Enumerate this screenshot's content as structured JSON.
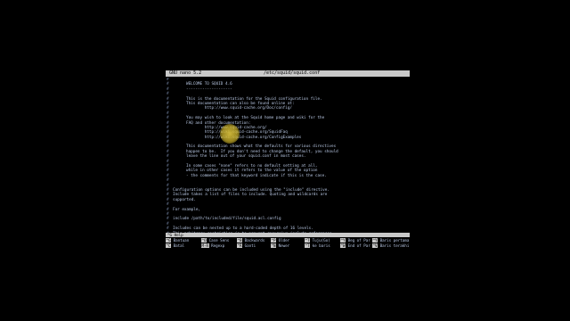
{
  "titlebar": {
    "app": "GNU nano 5.2",
    "file": "/etc/squid/squid.conf"
  },
  "lines": [
    {
      "h": "#",
      "t": ""
    },
    {
      "h": "#",
      "t": "WELCOME TO SQUID 4.6"
    },
    {
      "h": "#",
      "t": "--------------------"
    },
    {
      "h": "#",
      "t": ""
    },
    {
      "h": "#",
      "t": "This is the documentation for the Squid configuration file."
    },
    {
      "h": "#",
      "t": "This documentation can also be found online at:"
    },
    {
      "h": "#",
      "t": "        http://www.squid-cache.org/Doc/config/"
    },
    {
      "h": "#",
      "t": ""
    },
    {
      "h": "#",
      "t": "You may wish to look at the Squid home page and wiki for the"
    },
    {
      "h": "#",
      "t": "FAQ and other documentation:"
    },
    {
      "h": "#",
      "t": "        http://www.squid-cache.org/"
    },
    {
      "h": "#",
      "t": "        http://wiki.squid-cache.org/SquidFaq"
    },
    {
      "h": "#",
      "t": "        http://wiki.squid-cache.org/ConfigExamples"
    },
    {
      "h": "#",
      "t": ""
    },
    {
      "h": "#",
      "t": "This documentation shows what the defaults for various directives"
    },
    {
      "h": "#",
      "t": "happen to be.  If you don't need to change the default, you should"
    },
    {
      "h": "#",
      "t": "leave the line out of your squid.conf in most cases."
    },
    {
      "h": "#",
      "t": ""
    },
    {
      "h": "#",
      "t": "In some cases \"none\" refers to no default setting at all,"
    },
    {
      "h": "#",
      "t": "while in other cases it refers to the value of the option"
    },
    {
      "h": "#",
      "t": "- the comments for that keyword indicate if this is the case."
    },
    {
      "h": "#",
      "t": ""
    },
    {
      "h": "#",
      "t": "",
      "block": true
    },
    {
      "h": "#",
      "t": "Configuration options can be included using the \"include\" directive.",
      "block": true
    },
    {
      "h": "#",
      "t": "Include takes a list of files to include. Quoting and wildcards are",
      "block": true
    },
    {
      "h": "#",
      "t": "supported.",
      "block": true
    },
    {
      "h": "#",
      "t": "",
      "block": true
    },
    {
      "h": "#",
      "t": "For example,",
      "block": true
    },
    {
      "h": "#",
      "t": "",
      "block": true
    },
    {
      "h": "#",
      "t": "include /path/to/included/file/squid.acl.config",
      "block": true
    },
    {
      "h": "#",
      "t": "",
      "block": true
    },
    {
      "h": "#",
      "t": "Includes can be nested up to a hard-coded depth of 16 levels.",
      "block": true
    },
    {
      "h": "#",
      "t": "This arbitrary restriction is to prevent recursive include references",
      "block": true
    }
  ],
  "statusbar": "^G Help",
  "shortcuts": [
    [
      {
        "key": "^G",
        "label": "Bantuan"
      },
      {
        "key": "^O",
        "label": "Case Sens"
      },
      {
        "key": "^B",
        "label": "Backwards"
      },
      {
        "key": "^P",
        "label": "Older"
      },
      {
        "key": "^T",
        "label": "Tuju(Go)"
      },
      {
        "key": "^Y",
        "label": "Beg of Par"
      },
      {
        "key": "^Y",
        "label": "Baris pertama"
      }
    ],
    [
      {
        "key": "^C",
        "label": "Batal"
      },
      {
        "key": "M-R",
        "label": "Regexp"
      },
      {
        "key": "^R",
        "label": "Ganti"
      },
      {
        "key": "^N",
        "label": "Newer"
      },
      {
        "key": "^T",
        "label": "ke baris"
      },
      {
        "key": "^W",
        "label": "End of Par"
      },
      {
        "key": "^V",
        "label": "Baris terakhir"
      }
    ]
  ]
}
